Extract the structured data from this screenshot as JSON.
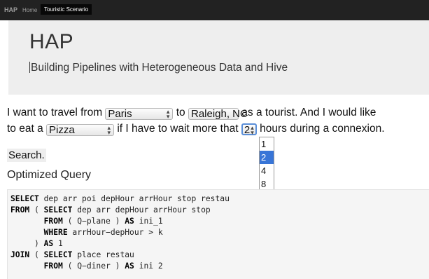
{
  "navbar": {
    "brand": "HAP",
    "links": [
      "Home",
      "Touristic Scenario"
    ]
  },
  "jumbotron": {
    "title": "HAP",
    "subtitle": "Building Pipelines with Heterogeneous Data and Hive"
  },
  "form": {
    "text_1": "I want to travel from",
    "from_value": "Paris",
    "text_2": "to",
    "to_value": "Raleigh, NC",
    "text_3": "as a tourist. And I would like",
    "text_4": "to eat a",
    "food_value": "Pizza",
    "text_5": "if I have to wait more that",
    "wait_value": "2",
    "text_6": "hours during a connexion.",
    "wait_options": [
      "1",
      "2",
      "4",
      "8"
    ],
    "wait_selected_index": 1,
    "search_label": "Search."
  },
  "query": {
    "heading": "Optimized Query",
    "lines": [
      [
        {
          "kw": "SELECT"
        },
        {
          "t": " dep arr poi depHour arrHour stop restau"
        }
      ],
      [
        {
          "kw": "FROM"
        },
        {
          "t": " ( "
        },
        {
          "kw": "SELECT"
        },
        {
          "t": " dep arr depHour arrHour stop"
        }
      ],
      [
        {
          "t": "       "
        },
        {
          "kw": "FROM"
        },
        {
          "t": " ( Q−plane ) "
        },
        {
          "kw": "AS"
        },
        {
          "t": " ini_1"
        }
      ],
      [
        {
          "t": "       "
        },
        {
          "kw": "WHERE"
        },
        {
          "t": " arrHour−depHour > k"
        }
      ],
      [
        {
          "t": "     ) "
        },
        {
          "kw": "AS"
        },
        {
          "t": " 1"
        }
      ],
      [
        {
          "kw": "JOIN"
        },
        {
          "t": " ( "
        },
        {
          "kw": "SELECT"
        },
        {
          "t": " place restau"
        }
      ],
      [
        {
          "t": "       "
        },
        {
          "kw": "FROM"
        },
        {
          "t": " ( Q−diner ) "
        },
        {
          "kw": "AS"
        },
        {
          "t": " ini 2"
        }
      ]
    ]
  },
  "colors": {
    "navbar_bg": "#222222",
    "jumbotron_bg": "#eeeeee",
    "selected_option": "#3875d7"
  }
}
